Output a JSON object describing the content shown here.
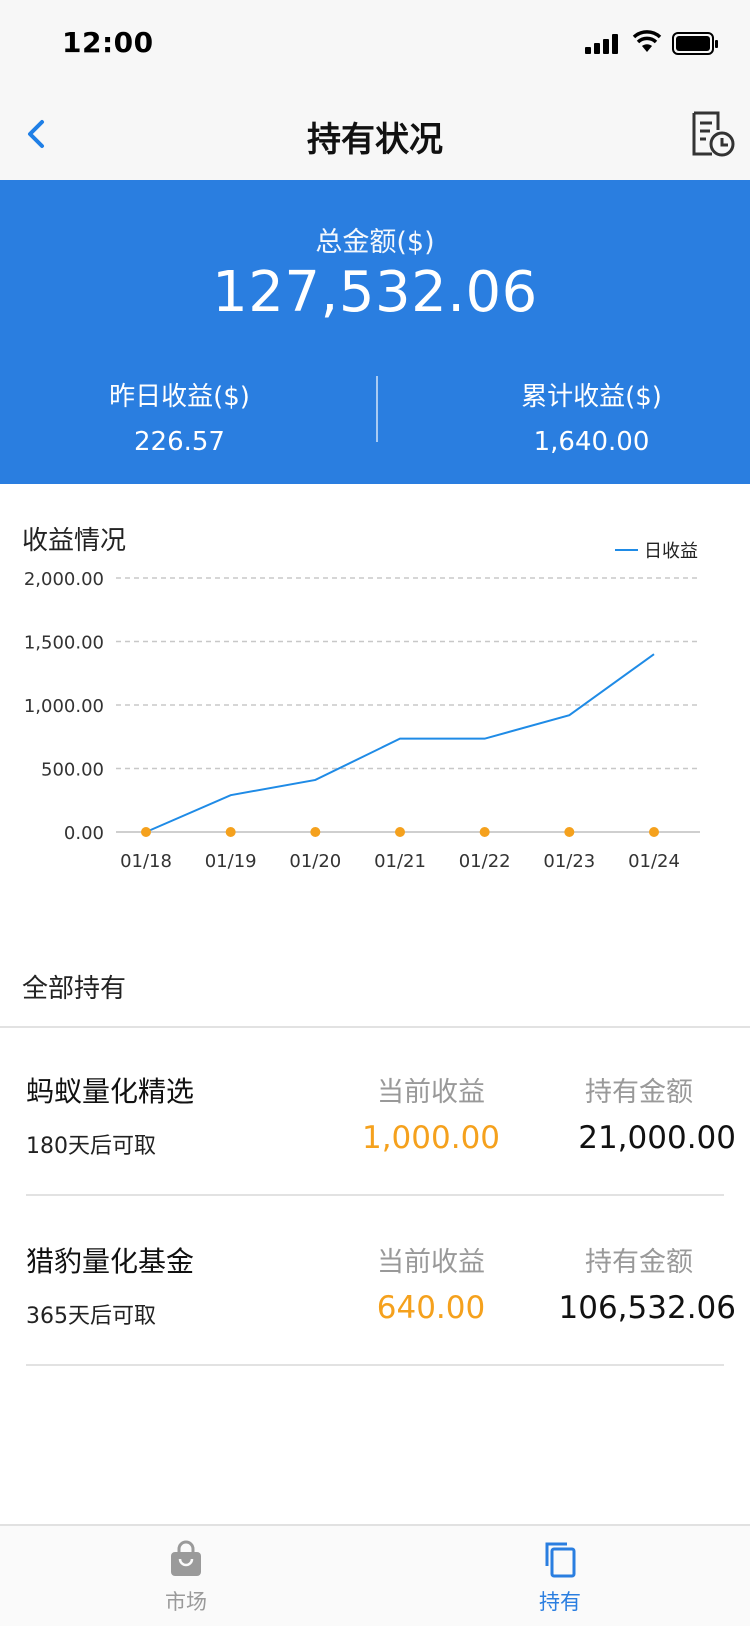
{
  "status_bar": {
    "time": "12:00"
  },
  "nav": {
    "title": "持有状况",
    "back_icon": "chevron-left-icon",
    "history_icon": "document-clock-icon"
  },
  "summary": {
    "total_label": "总金额($)",
    "total_value": "127,532.06",
    "yesterday_label": "昨日收益($)",
    "yesterday_value": "226.57",
    "cumulative_label": "累计收益($)",
    "cumulative_value": "1,640.00"
  },
  "chart_section": {
    "title": "收益情况"
  },
  "chart_data": {
    "type": "line",
    "categories": [
      "01/18",
      "01/19",
      "01/20",
      "01/21",
      "01/22",
      "01/23",
      "01/24"
    ],
    "series": [
      {
        "name": "日收益",
        "values": [
          0,
          290,
          410,
          735,
          735,
          920,
          1400
        ],
        "color": "#1f8be6"
      }
    ],
    "marker_series_color": "#f5a11d",
    "y_ticks": [
      "0.00",
      "500.00",
      "1,000.00",
      "1,500.00",
      "2,000.00"
    ],
    "ylim": [
      0,
      2000
    ],
    "grid": true,
    "legend_position": "top-right"
  },
  "holdings_section": {
    "title": "全部持有"
  },
  "holdings": [
    {
      "name": "蚂蚁量化精选",
      "term": "180天后可取",
      "current_label": "当前收益",
      "current_value": "1,000.00",
      "amount_label": "持有金额",
      "amount_value": "21,000.00"
    },
    {
      "name": "猎豹量化基金",
      "term": "365天后可取",
      "current_label": "当前收益",
      "current_value": "640.00",
      "amount_label": "持有金额",
      "amount_value": "106,532.06"
    }
  ],
  "tabbar": {
    "items": [
      {
        "label": "市场",
        "icon": "shopping-bag-icon",
        "active": false
      },
      {
        "label": "持有",
        "icon": "copy-icon",
        "active": true
      }
    ]
  },
  "colors": {
    "accent": "#2a7ee0",
    "positive": "#f5a11d"
  }
}
